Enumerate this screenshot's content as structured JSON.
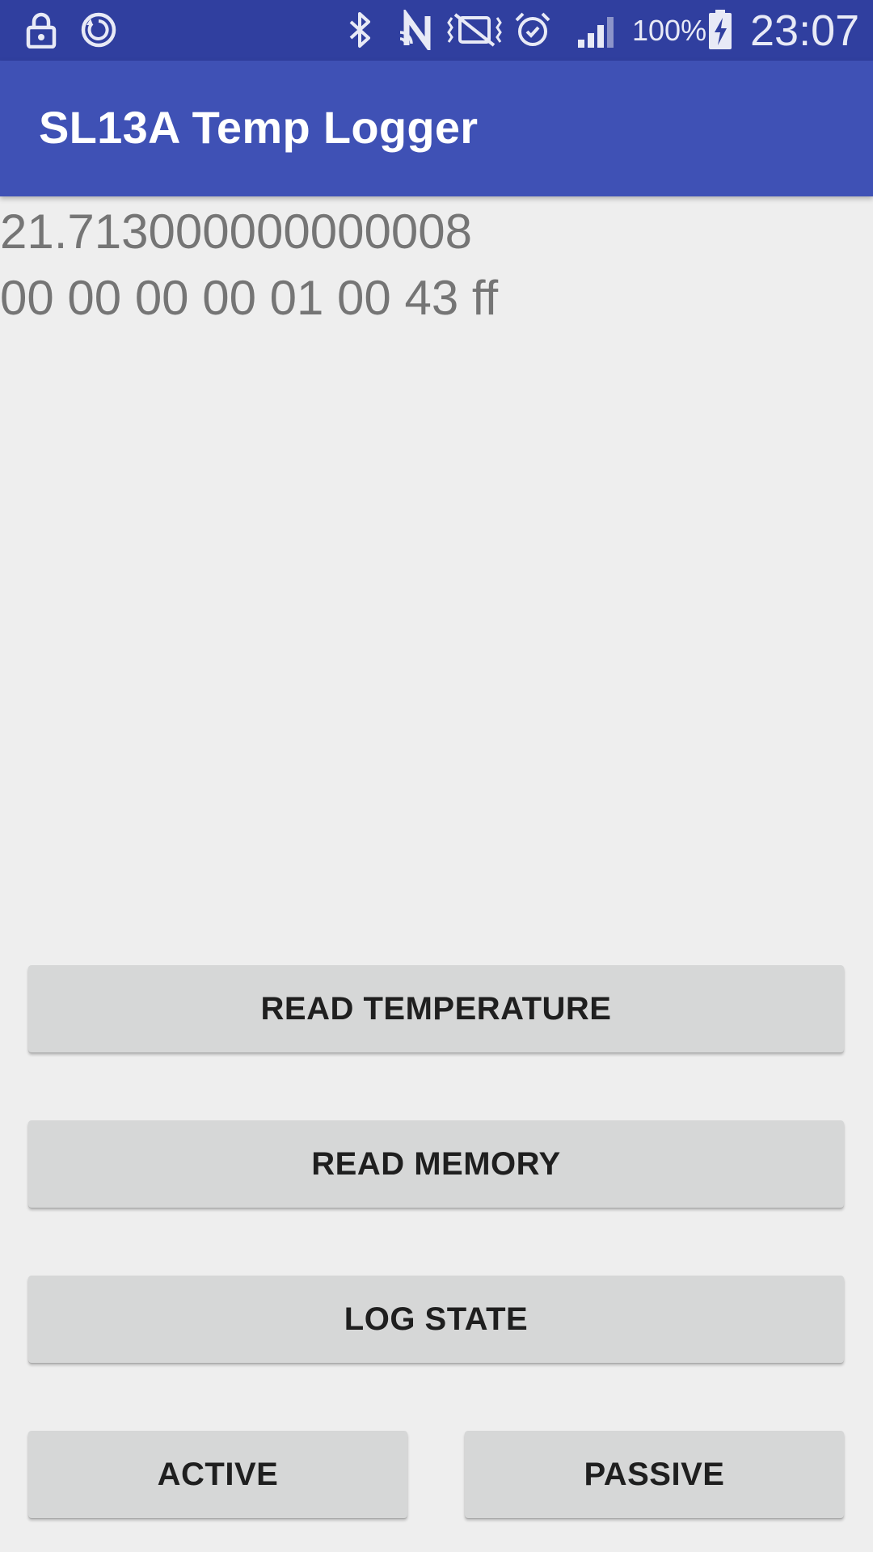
{
  "status_bar": {
    "icons_left": [
      "lock-icon",
      "sync-icon"
    ],
    "icons_right": [
      "bluetooth-icon",
      "nfc-icon",
      "vibrate-icon",
      "alarm-icon",
      "signal-icon",
      "battery-charging-icon"
    ],
    "battery_percent": "100%",
    "time": "23:07",
    "background_color": "#303f9f"
  },
  "app_bar": {
    "title": "SL13A Temp Logger",
    "background_color": "#3f51b5"
  },
  "readout": {
    "temperature": "21.713000000000008",
    "memory_bytes": "00 00 00 00 01 00 43 ff"
  },
  "buttons": {
    "read_temperature": "READ TEMPERATURE",
    "read_memory": "READ MEMORY",
    "log_state": "LOG STATE",
    "active": "ACTIVE",
    "passive": "PASSIVE",
    "background_color": "#d6d7d7"
  }
}
